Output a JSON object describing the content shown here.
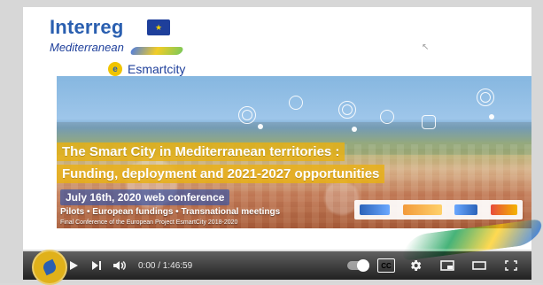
{
  "slide": {
    "brand_interreg": "Interreg",
    "brand_mediterranean": "Mediterranean",
    "brand_esmartcity": "Esmartcity"
  },
  "banner": {
    "title_line1": "The Smart City in Mediterranean territories :",
    "title_line2": "Funding, deployment and 2021-2027 opportunities",
    "date": "July 16th, 2020 web conference",
    "tags": "Pilots • European fundings • Transnational meetings",
    "final_conference": "Final Conference of the European Project EsmartCity 2018-2020"
  },
  "player": {
    "time": "0:00 / 1:46:59",
    "icons": {
      "play": "play-icon",
      "next": "next-icon",
      "volume": "volume-icon",
      "autoplay": "autoplay-toggle-icon",
      "cc": "closed-captions-icon",
      "settings": "gear-icon",
      "miniplayer": "miniplayer-icon",
      "theater": "theater-mode-icon",
      "fullscreen": "fullscreen-icon"
    },
    "cc_label": "CC"
  },
  "colors": {
    "brand_blue": "#2a5fb0",
    "brand_yellow": "#e0b11a"
  }
}
